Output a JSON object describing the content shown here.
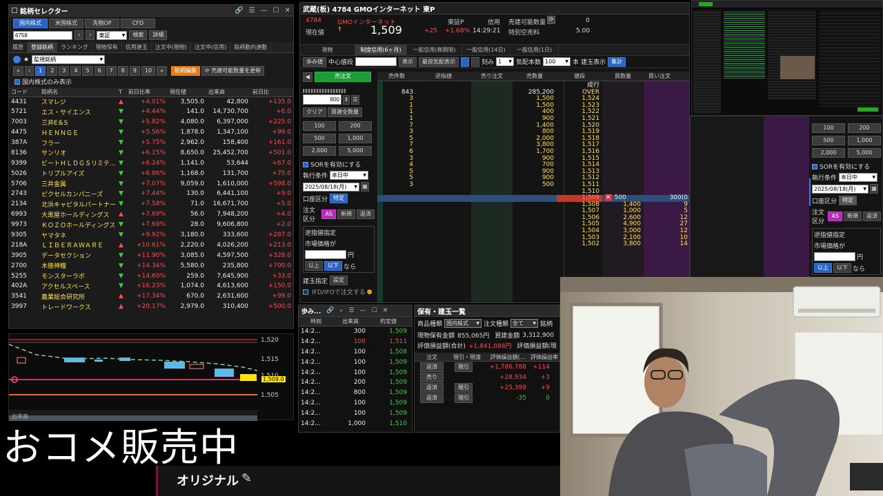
{
  "selector": {
    "title": "銘柄セレクター",
    "market_tabs": [
      "国内株式",
      "米国株式",
      "先物OP",
      "CFD"
    ],
    "code_value": "6758",
    "exchange_value": "東証",
    "search_label": "検索",
    "detail_label": "詳細",
    "sub_tabs": [
      "履歴",
      "登録銘柄",
      "ランキング",
      "現物保有",
      "信用建玉",
      "注文中(現物)",
      "注文中(信用)",
      "銘柄動向連動"
    ],
    "list_name": "監視銘柄",
    "pages": [
      "1",
      "2",
      "3",
      "4",
      "5",
      "6",
      "7",
      "8",
      "9",
      "10"
    ],
    "edit_label": "銘柄編集",
    "refresh_label": "売建可能数量を更新",
    "domestic_only_label": "国内株式のみ表示",
    "columns": [
      "コード",
      "銘柄名",
      "T",
      "前日比率",
      "現在値",
      "出来高",
      "前日比"
    ],
    "rows": [
      {
        "code": "4431",
        "name": "スマレジ",
        "dir": "up",
        "pct": "+4.01%",
        "price": "3,505.0",
        "vol": "42,800",
        "chg": "+135.0"
      },
      {
        "code": "5721",
        "name": "エス・サイエンス",
        "dir": "dn",
        "pct": "+4.44%",
        "price": "141.0",
        "vol": "14,730,700",
        "chg": "+6.0"
      },
      {
        "code": "7003",
        "name": "三井E＆S",
        "dir": "dn",
        "pct": "+5.82%",
        "price": "4,080.0",
        "vol": "6,397,000",
        "chg": "+225.0"
      },
      {
        "code": "4475",
        "name": "ＨＥＮＮＧＥ",
        "dir": "dn",
        "pct": "+5.56%",
        "price": "1,878.0",
        "vol": "1,347,100",
        "chg": "+99.0"
      },
      {
        "code": "387A",
        "name": "フラー",
        "dir": "dn",
        "pct": "+5.75%",
        "price": "2,962.0",
        "vol": "158,400",
        "chg": "+161.0"
      },
      {
        "code": "8136",
        "name": "サンリオ",
        "dir": "dn",
        "pct": "+6.15%",
        "price": "8,650.0",
        "vol": "25,452,700",
        "chg": "+501.0"
      },
      {
        "code": "9399",
        "name": "ビートＨＬＤＧＳリミテ...",
        "dir": "dn",
        "pct": "+6.24%",
        "price": "1,141.0",
        "vol": "53,644",
        "chg": "+67.0"
      },
      {
        "code": "5026",
        "name": "トリプルアイズ",
        "dir": "dn",
        "pct": "+6.86%",
        "price": "1,168.0",
        "vol": "131,700",
        "chg": "+75.0"
      },
      {
        "code": "5706",
        "name": "三井金属",
        "dir": "dn",
        "pct": "+7.07%",
        "price": "9,059.0",
        "vol": "1,610,000",
        "chg": "+598.0"
      },
      {
        "code": "2743",
        "name": "ピクセルカンパニーズ",
        "dir": "dn",
        "pct": "+7.44%",
        "price": "130.0",
        "vol": "6,441,100",
        "chg": "+9.0"
      },
      {
        "code": "2134",
        "name": "北浜キャピタルパートナー",
        "dir": "dn",
        "pct": "+7.58%",
        "price": "71.0",
        "vol": "16,671,700",
        "chg": "+5.0"
      },
      {
        "code": "6993",
        "name": "大黒屋ホールディングス",
        "dir": "up",
        "pct": "+7.69%",
        "price": "56.0",
        "vol": "7,948,200",
        "chg": "+4.0"
      },
      {
        "code": "9973",
        "name": "ＫＯＺＯホールディングス",
        "dir": "dn",
        "pct": "+7.69%",
        "price": "28.0",
        "vol": "9,606,800",
        "chg": "+2.0"
      },
      {
        "code": "9305",
        "name": "ヤマタネ",
        "dir": "dn",
        "pct": "+9.92%",
        "price": "3,180.0",
        "vol": "333,600",
        "chg": "+287.0"
      },
      {
        "code": "218A",
        "name": "ＬＩＢＥＲＡＷＡＲＥ",
        "dir": "up",
        "pct": "+10.61%",
        "price": "2,220.0",
        "vol": "4,026,200",
        "chg": "+213.0"
      },
      {
        "code": "3905",
        "name": "データセクション",
        "dir": "dn",
        "pct": "+11.90%",
        "price": "3,085.0",
        "vol": "4,597,500",
        "chg": "+328.0"
      },
      {
        "code": "2700",
        "name": "木徳神糧",
        "dir": "dn",
        "pct": "+14.34%",
        "price": "5,580.0",
        "vol": "235,800",
        "chg": "+700.0"
      },
      {
        "code": "5255",
        "name": "モンスターラボ",
        "dir": "dn",
        "pct": "+14.60%",
        "price": "259.0",
        "vol": "7,645,900",
        "chg": "+33.0"
      },
      {
        "code": "402A",
        "name": "アクセルスペース",
        "dir": "dn",
        "pct": "+16.23%",
        "price": "1,074.0",
        "vol": "4,613,600",
        "chg": "+150.0"
      },
      {
        "code": "3541",
        "name": "農業総合研究所",
        "dir": "up",
        "pct": "+17.34%",
        "price": "670.0",
        "vol": "2,631,600",
        "chg": "+99.0"
      },
      {
        "code": "3997",
        "name": "トレードワークス",
        "dir": "up",
        "pct": "+20.17%",
        "price": "2,979.0",
        "vol": "310,400",
        "chg": "+500.0"
      }
    ]
  },
  "mini_chart": {
    "y_labels": [
      "1,520",
      "1,515",
      "1,510",
      "1,505"
    ],
    "current": "1,509.0",
    "volume_label": "出来高"
  },
  "board": {
    "title": "武蔵(板) 4784 GMOインターネット 東P",
    "code": "4784",
    "name": "GMOインターネット",
    "current_label": "現在値",
    "price": "1,509",
    "market": "東証P",
    "change": "+25",
    "change_pct": "+1.68%",
    "time": "14:29:21",
    "credit_label": "信用",
    "short_qty_label": "売建可能数量",
    "short_qty": "0",
    "special_fee_label": "特別空売料",
    "special_fee": "5.00",
    "tabs": [
      "現物",
      "制度信用(6ヶ月)",
      "一般信用(無期限)",
      "一般信用(14日)",
      "一般信用(1日)"
    ],
    "toolbar": {
      "ayumi": "歩み値",
      "center": "中心値段",
      "show": "表示",
      "best": "最良気配表示",
      "tick_label": "刻み",
      "tick": "1",
      "qty_label": "気配本数",
      "qty": "100",
      "unit": "本",
      "build": "建玉表示",
      "ichiba": "集計"
    },
    "sell_order": "売注文",
    "order_qty": "800",
    "clear": "クリア",
    "buy_all": "買建全数量",
    "qty_buttons": [
      "100",
      "200",
      "500",
      "1,000",
      "2,000",
      "5,000"
    ],
    "sor_label": "SORを有効にする",
    "cond_label": "執行条件",
    "cond_value": "本日中",
    "date_value": "2025/08/18(月)",
    "account_label": "口座区分",
    "account_value": "特定",
    "order_type_label": "注文区分",
    "order_types": [
      "AS",
      "新規",
      "返済"
    ],
    "reverse_label": "逆指値指定",
    "market_price_label": "市場価格が",
    "yen": "円",
    "above": "以上",
    "below": "以下",
    "nara": "なら",
    "build_spec": "建玉指定",
    "settings": "設定",
    "ifd_label": "IFD/IFOで注文する",
    "cols": [
      "売件数",
      "逆指値",
      "売り注文",
      "売数量",
      "値段",
      "買数量",
      "買い注文"
    ],
    "over_row": {
      "count": "843",
      "qty": "285,200",
      "price": "OVER"
    },
    "sells": [
      {
        "c": "3",
        "q": "1,500",
        "p": "1,524"
      },
      {
        "c": "1",
        "q": "1,500",
        "p": "1,523"
      },
      {
        "c": "1",
        "q": "400",
        "p": "1,522"
      },
      {
        "c": "1",
        "q": "900",
        "p": "1,521"
      },
      {
        "c": "7",
        "q": "1,400",
        "p": "1,520"
      },
      {
        "c": "3",
        "q": "800",
        "p": "1,519"
      },
      {
        "c": "5",
        "q": "2,000",
        "p": "1,518"
      },
      {
        "c": "7",
        "q": "3,800",
        "p": "1,517"
      },
      {
        "c": "6",
        "q": "1,700",
        "p": "1,516"
      },
      {
        "c": "3",
        "q": "900",
        "p": "1,515"
      },
      {
        "c": "4",
        "q": "700",
        "p": "1,514"
      },
      {
        "c": "5",
        "q": "900",
        "p": "1,513"
      },
      {
        "c": "5",
        "q": "900",
        "p": "1,512"
      },
      {
        "c": "3",
        "q": "500",
        "p": "1,511"
      },
      {
        "c": "",
        "q": "",
        "p": "1,510"
      }
    ],
    "current_row": {
      "price": "1,509",
      "qty": "500",
      "right": "300(0"
    },
    "market_label": "成行",
    "buys": [
      {
        "p": "1,508",
        "q": "1,400",
        "c": "9"
      },
      {
        "p": "1,507",
        "q": "1,000",
        "c": "5"
      },
      {
        "p": "1,506",
        "q": "2,600",
        "c": "12"
      },
      {
        "p": "1,505",
        "q": "4,900",
        "c": "27"
      },
      {
        "p": "1,504",
        "q": "3,000",
        "c": "12"
      },
      {
        "p": "1,503",
        "q": "2,100",
        "c": "10"
      },
      {
        "p": "1,502",
        "q": "3,800",
        "c": "14"
      }
    ]
  },
  "ticks": {
    "title": "歩み...",
    "cols": [
      "時刻",
      "出来高",
      "約定値"
    ],
    "rows": [
      {
        "t": "14:2...",
        "v": "300",
        "p": "1,509",
        "cls": "dn"
      },
      {
        "t": "14:2...",
        "v": "100",
        "p": "1,511",
        "cls": "up"
      },
      {
        "t": "14:2...",
        "v": "100",
        "p": "1,508",
        "cls": "dn"
      },
      {
        "t": "14:2...",
        "v": "100",
        "p": "1,509",
        "cls": "dn"
      },
      {
        "t": "14:2...",
        "v": "100",
        "p": "1,509",
        "cls": "dn"
      },
      {
        "t": "14:2...",
        "v": "200",
        "p": "1,509",
        "cls": "dn"
      },
      {
        "t": "14:2...",
        "v": "800",
        "p": "1,509",
        "cls": "dn"
      },
      {
        "t": "14:2...",
        "v": "100",
        "p": "1,509",
        "cls": "dn"
      },
      {
        "t": "14:2...",
        "v": "100",
        "p": "1,509",
        "cls": "dn"
      },
      {
        "t": "14:2...",
        "v": "1,000",
        "p": "1,510",
        "cls": "dn"
      }
    ]
  },
  "positions": {
    "title": "保有・建玉一覧",
    "product_label": "商品種類",
    "product_value": "国内株式",
    "order_kind_label": "注文種類",
    "order_kind_value": "全て",
    "brand_label": "銘柄",
    "spot_amount_label": "現物保有金額",
    "spot_amount": "855,065円",
    "buy_amount_label": "買建金額",
    "buy_amount": "3,312,900",
    "pl_label": "評価損益額(合計)",
    "pl_value": "+1,841,088円",
    "pl2_label": "評価損益額(現",
    "cols": [
      "注文",
      "現引・現渡",
      "評価損益額(...",
      "評価損益率"
    ],
    "rows": [
      {
        "a": "返済",
        "b": "現引",
        "c": "+1,786,788",
        "d": "+114"
      },
      {
        "a": "売り",
        "b": "",
        "c": "+28,934",
        "d": "+3"
      },
      {
        "a": "返済",
        "b": "現引",
        "c": "+25,399",
        "d": "+9"
      },
      {
        "a": "返済",
        "b": "現引",
        "c": "-35",
        "d": "0"
      }
    ]
  },
  "right_panel": {
    "qty_buttons": [
      "100",
      "200",
      "500",
      "1,000",
      "2,000",
      "5,000"
    ],
    "sor_label": "SORを有効にする",
    "cond_label": "執行条件",
    "cond_value": "本日中",
    "date_value": "2025/08/18(月)",
    "account_label": "口座区分",
    "account_value": "特定",
    "order_type_label": "注文区分",
    "order_types": [
      "AS",
      "新規",
      "返済"
    ],
    "reverse_label": "逆指値指定",
    "market_price_label": "市場価格が",
    "yen": "円",
    "above": "以上",
    "below": "以下",
    "nara": "なら"
  },
  "overlay": {
    "rice_text": "おコメ販売中",
    "original_text": "オリジナル"
  },
  "colors": {
    "up": "#ff4b4b",
    "down": "#3ad13a",
    "accent": "#2a63c2",
    "orange": "#e07b18"
  }
}
